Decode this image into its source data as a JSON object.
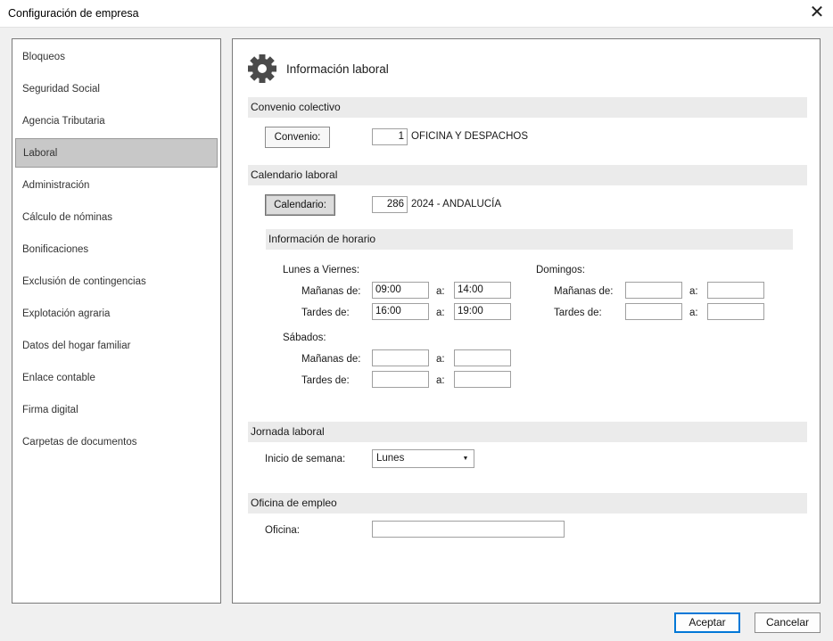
{
  "window": {
    "title": "Configuración de empresa",
    "close_glyph": "✕"
  },
  "sidebar": {
    "items": [
      {
        "label": "Bloqueos"
      },
      {
        "label": "Seguridad Social"
      },
      {
        "label": "Agencia Tributaria"
      },
      {
        "label": "Laboral",
        "active": true
      },
      {
        "label": "Administración"
      },
      {
        "label": "Cálculo de nóminas"
      },
      {
        "label": "Bonificaciones"
      },
      {
        "label": "Exclusión de contingencias"
      },
      {
        "label": "Explotación agraria"
      },
      {
        "label": "Datos del hogar familiar"
      },
      {
        "label": "Enlace contable"
      },
      {
        "label": "Firma digital"
      },
      {
        "label": "Carpetas de documentos"
      }
    ]
  },
  "main": {
    "title": "Información laboral",
    "icon": "gear-icon",
    "convenio": {
      "section": "Convenio colectivo",
      "button": "Convenio:",
      "code": "1",
      "name": "OFICINA Y DESPACHOS"
    },
    "calendario": {
      "section": "Calendario laboral",
      "button": "Calendario:",
      "code": "286",
      "name": "2024 - ANDALUCÍA"
    },
    "horario": {
      "section": "Información de horario",
      "weekdays": {
        "heading": "Lunes a Viernes:",
        "morning_label": "Mañanas de:",
        "afternoon_label": "Tardes de:",
        "to_label": "a:",
        "morning_from": "09:00",
        "morning_to": "14:00",
        "afternoon_from": "16:00",
        "afternoon_to": "19:00"
      },
      "sundays": {
        "heading": "Domingos:",
        "morning_label": "Mañanas de:",
        "afternoon_label": "Tardes de:",
        "to_label": "a:",
        "morning_from": "",
        "morning_to": "",
        "afternoon_from": "",
        "afternoon_to": ""
      },
      "saturdays": {
        "heading": "Sábados:",
        "morning_label": "Mañanas de:",
        "afternoon_label": "Tardes de:",
        "to_label": "a:",
        "morning_from": "",
        "morning_to": "",
        "afternoon_from": "",
        "afternoon_to": ""
      }
    },
    "jornada": {
      "section": "Jornada laboral",
      "week_start_label": "Inicio de semana:",
      "week_start_value": "Lunes"
    },
    "oficina": {
      "section": "Oficina de empleo",
      "label": "Oficina:",
      "value": ""
    }
  },
  "footer": {
    "accept": "Aceptar",
    "cancel": "Cancelar"
  },
  "colors": {
    "accent": "#0078d7",
    "section_bg": "#ebebeb",
    "active_item_bg": "#c8c8c8"
  }
}
